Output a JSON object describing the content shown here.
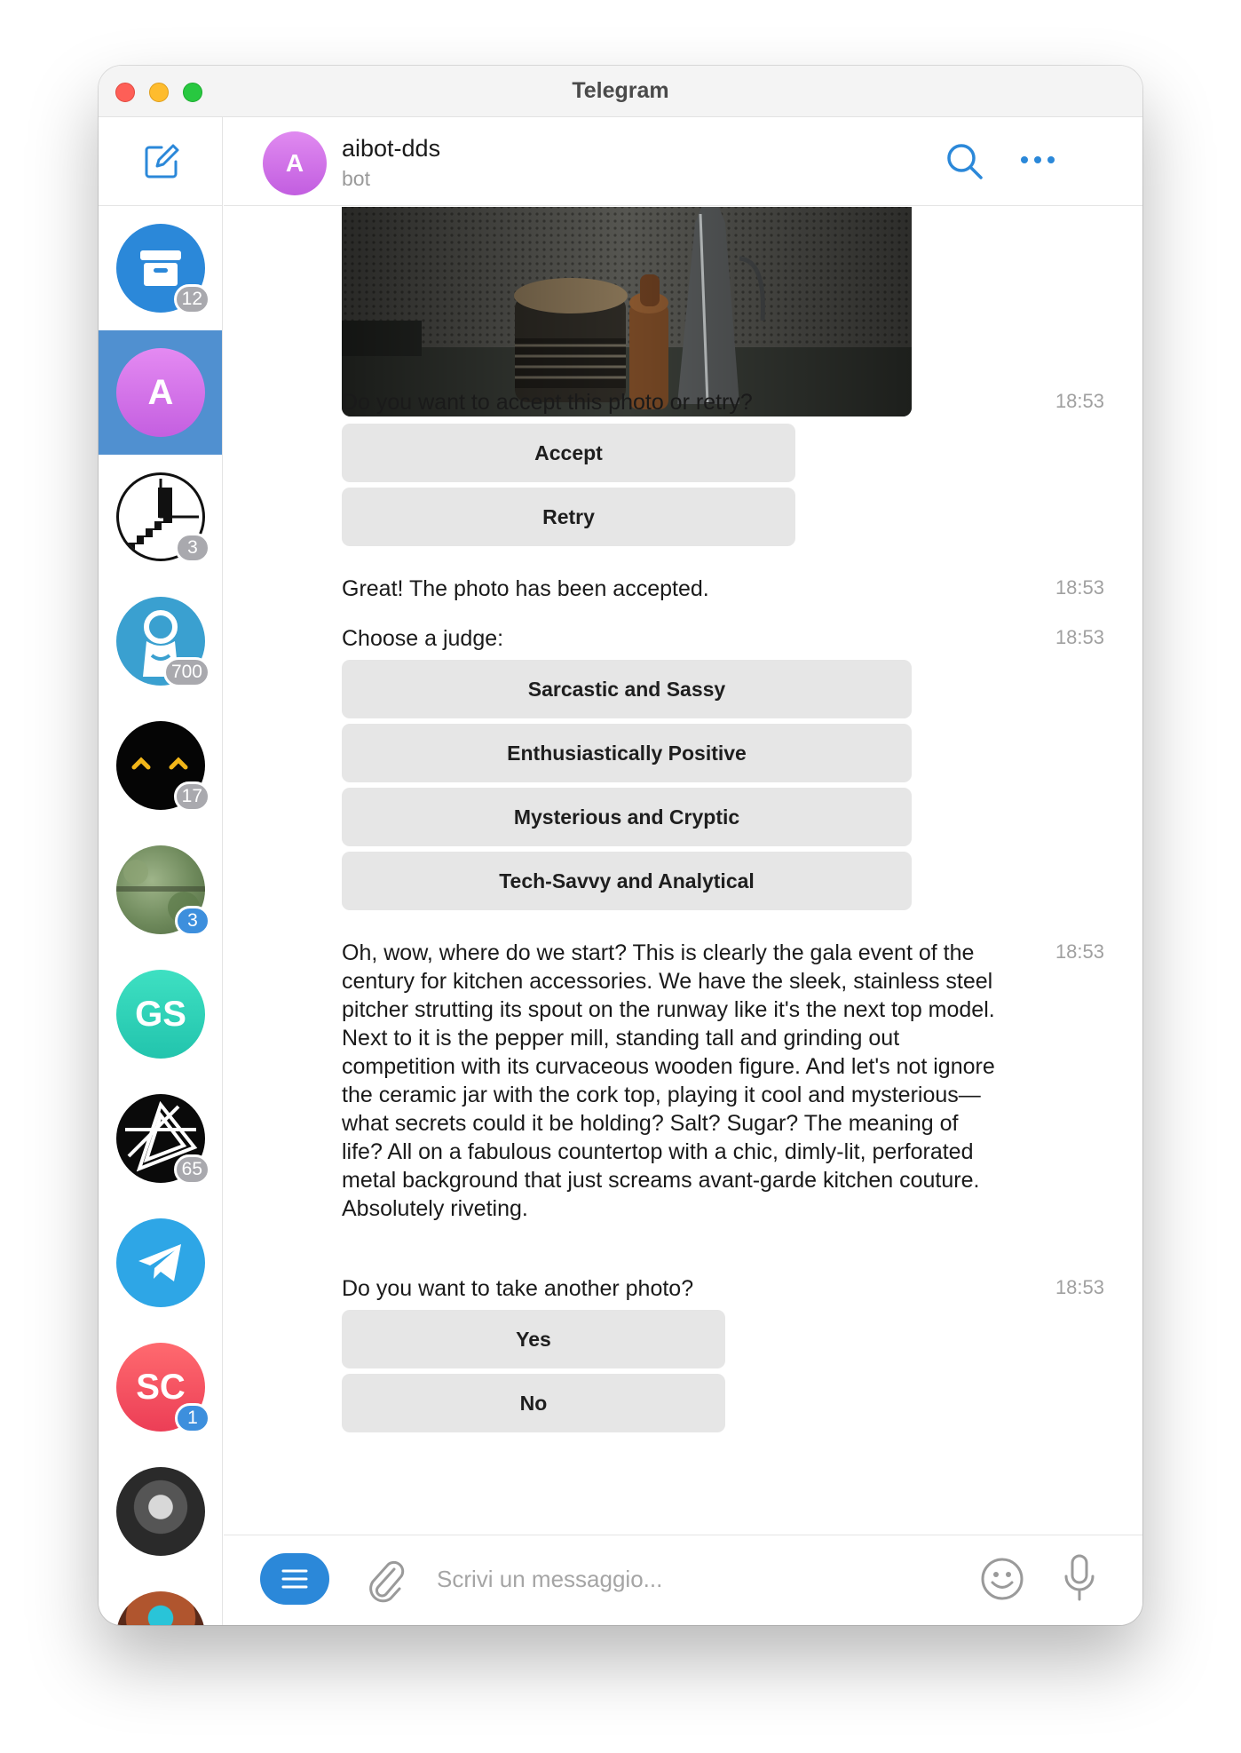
{
  "window": {
    "title": "Telegram"
  },
  "sidebar": {
    "chats": [
      {
        "name": "archive",
        "badge": "12",
        "badge_color": "gray",
        "avatar_color": "#2b88d9"
      },
      {
        "name": "aibot-dds",
        "initial": "A",
        "badge": "",
        "active": true,
        "avatar_color": "#d26de8"
      },
      {
        "name": "staircase-channel",
        "badge": "3",
        "badge_color": "gray"
      },
      {
        "name": "blue-character-chat",
        "badge": "700",
        "badge_color": "gray",
        "avatar_color": "#3aa0d0"
      },
      {
        "name": "black-face-chat",
        "badge": "17",
        "badge_color": "gray"
      },
      {
        "name": "forest-photo-chat",
        "badge": "3",
        "badge_color": "blue"
      },
      {
        "name": "gs-chat",
        "initial": "GS",
        "badge": "",
        "avatar_color": "#2fd3b8"
      },
      {
        "name": "geometric-chat",
        "badge": "65",
        "badge_color": "gray"
      },
      {
        "name": "telegram-chat",
        "badge": "",
        "avatar_color": "#2ea6e6"
      },
      {
        "name": "sc-chat",
        "initial": "SC",
        "badge": "1",
        "badge_color": "blue",
        "avatar_color": "#f34c5e"
      },
      {
        "name": "portrait-chat",
        "badge": ""
      },
      {
        "name": "partial-chat",
        "badge": ""
      }
    ]
  },
  "header": {
    "chat_name": "aibot-dds",
    "chat_initial": "A",
    "chat_subtitle": "bot"
  },
  "messages": [
    {
      "id": "m1",
      "text": "Do you want to accept this photo or retry?",
      "time": "18:53",
      "buttons": [
        "Accept",
        "Retry"
      ]
    },
    {
      "id": "m2",
      "text": "Great! The photo has been accepted.",
      "time": "18:53"
    },
    {
      "id": "m3",
      "text": "Choose a judge:",
      "time": "18:53",
      "buttons": [
        "Sarcastic and Sassy",
        "Enthusiastically Positive",
        "Mysterious and Cryptic",
        "Tech-Savvy and Analytical"
      ]
    },
    {
      "id": "m4",
      "text": "Oh, wow, where do we start? This is clearly the gala event of the century for kitchen accessories. We have the sleek, stainless steel pitcher strutting its spout on the runway like it's the next top model. Next to it is the pepper mill, standing tall and grinding out competition with its curvaceous wooden figure. And let's not ignore the ceramic jar with the cork top, playing it cool and mysterious—what secrets could it be holding? Salt? Sugar? The meaning of life? All on a fabulous countertop with a chic, dimly-lit, perforated metal background that just screams avant-garde kitchen couture. Absolutely riveting.",
      "time": "18:53"
    },
    {
      "id": "m5",
      "text": "Do you want to take another photo?",
      "time": "18:53",
      "buttons": [
        "Yes",
        "No"
      ]
    }
  ],
  "composer": {
    "placeholder": "Scrivi un messaggio..."
  },
  "colors": {
    "accent": "#2b88d9",
    "button_bg": "#e6e6e6",
    "active_chat": "#5090d0"
  }
}
